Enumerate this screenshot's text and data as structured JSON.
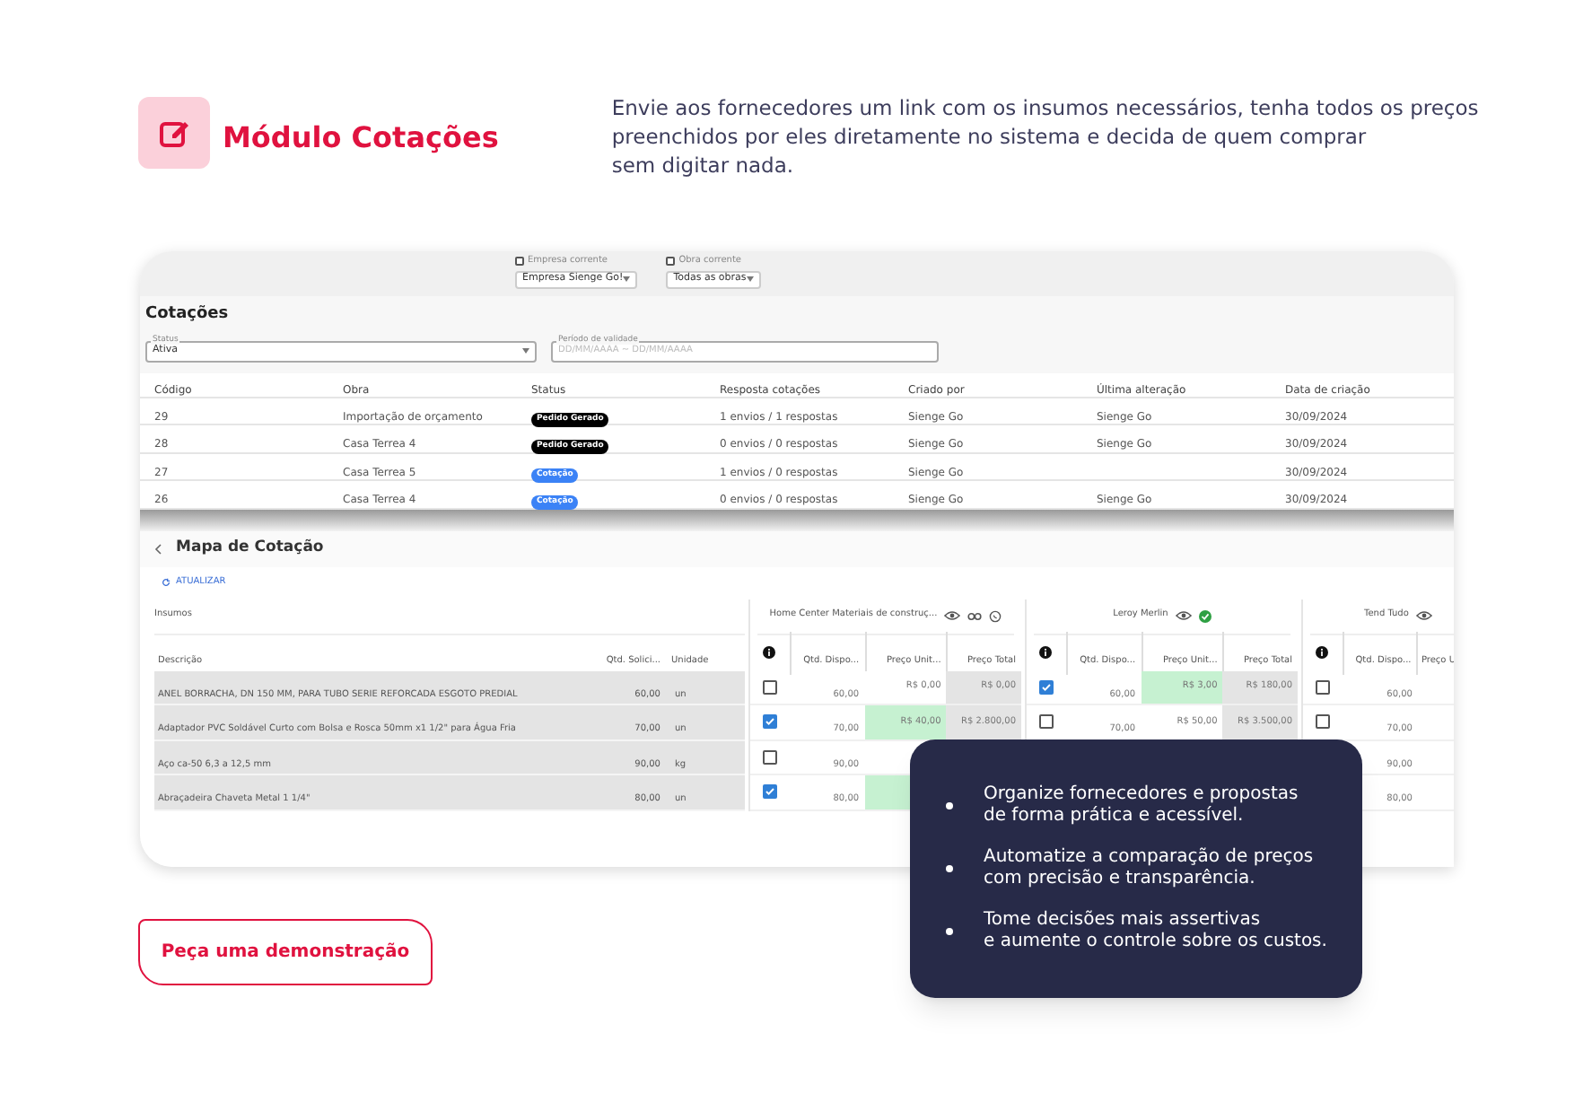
{
  "header": {
    "title": "Módulo Cotações",
    "description_lines": [
      "Envie aos fornecedores um link com os insumos necessários, tenha todos os preços",
      "preenchidos por eles diretamente no sistema e decida de quem comprar",
      "sem digitar nada."
    ]
  },
  "app": {
    "company_filter": {
      "label": "Empresa corrente",
      "checked": false,
      "value": "Empresa Sienge Go!"
    },
    "work_filter": {
      "label": "Obra corrente",
      "checked": false,
      "value": "Todas as obras"
    },
    "title": "Cotações",
    "status_filter": {
      "label": "Status",
      "value": "Ativa"
    },
    "period_filter": {
      "label": "Período de validade",
      "placeholder": "DD/MM/AAAA ~ DD/MM/AAAA"
    },
    "table": {
      "columns": [
        "Código",
        "Obra",
        "Status",
        "Resposta cotações",
        "Criado por",
        "Última alteração",
        "Data de criação"
      ],
      "rows": [
        {
          "code": "29",
          "work": "Importação de orçamento",
          "status": {
            "label": "Pedido Gerado",
            "kind": "order"
          },
          "responses": "1 envios / 1 respostas",
          "created_by": "Sienge Go",
          "last_change": "Sienge Go",
          "created": "30/09/2024"
        },
        {
          "code": "28",
          "work": "Casa Terrea 4",
          "status": {
            "label": "Pedido Gerado",
            "kind": "order"
          },
          "responses": "0 envios / 0 respostas",
          "created_by": "Sienge Go",
          "last_change": "Sienge Go",
          "created": "30/09/2024"
        },
        {
          "code": "27",
          "work": "Casa Terrea 5",
          "status": {
            "label": "Cotação",
            "kind": "quote"
          },
          "responses": "1 envios / 0 respostas",
          "created_by": "Sienge Go",
          "created": "30/09/2024"
        },
        {
          "code": "26",
          "work": "Casa Terrea 4",
          "status": {
            "label": "Cotação",
            "kind": "quote"
          },
          "responses": "0 envios / 0 respostas",
          "created_by": "Sienge Go",
          "last_change": "Sienge Go",
          "created": "30/09/2024"
        }
      ]
    }
  },
  "map": {
    "title": "Mapa de Cotação",
    "refresh": "ATUALIZAR",
    "items_group": "Insumos",
    "item_columns": [
      "Descrição",
      "Qtd. Solici...",
      "Unidade"
    ],
    "items": [
      {
        "description": "ANEL BORRACHA, DN 150 MM, PARA TUBO SERIE REFORCADA ESGOTO PREDIAL",
        "qty": "60,00",
        "unit": "un"
      },
      {
        "description": "Adaptador PVC Soldável Curto com Bolsa e Rosca 50mm x1 1/2\" para Água Fria",
        "qty": "70,00",
        "unit": "un"
      },
      {
        "description": "Aço ca-50 6,3 a 12,5 mm",
        "qty": "90,00",
        "unit": "kg"
      },
      {
        "description": "Abraçadeira Chaveta Metal 1 1/4\"",
        "qty": "80,00",
        "unit": "un"
      }
    ],
    "suppliers": [
      {
        "name": "Home Center Materiais de construç...",
        "approved": false,
        "columns": [
          "Qtd. Dispo...",
          "Preço Unit...",
          "Preço Total"
        ],
        "cells": [
          {
            "checked": false,
            "best": false,
            "qty": "60,00",
            "unit_price": "R$ 0,00",
            "total": "R$ 0,00"
          },
          {
            "checked": true,
            "best": true,
            "qty": "70,00",
            "unit_price": "R$ 40,00",
            "total": "R$ 2.800,00"
          },
          {
            "checked": false,
            "best": false,
            "qty": "90,00"
          },
          {
            "checked": true,
            "best": true,
            "qty": "80,00"
          }
        ]
      },
      {
        "name": "Leroy Merlin",
        "approved": true,
        "columns": [
          "Qtd. Dispo...",
          "Preço Unit...",
          "Preço Total"
        ],
        "cells": [
          {
            "checked": true,
            "best": true,
            "qty": "60,00",
            "unit_price": "R$ 3,00",
            "total": "R$ 180,00"
          },
          {
            "checked": false,
            "best": false,
            "qty": "70,00",
            "unit_price": "R$ 50,00",
            "total": "R$ 3.500,00"
          }
        ]
      },
      {
        "name": "Tend Tudo",
        "columns": [
          "Qtd. Dispo...",
          "Preço U"
        ],
        "cells": [
          {
            "checked": false,
            "qty": "60,00"
          },
          {
            "checked": false,
            "qty": "70,00"
          },
          {
            "qty": "90,00"
          },
          {
            "qty": "80,00"
          }
        ]
      }
    ]
  },
  "cta": "Peça uma demonstração",
  "highlights": [
    {
      "lines": [
        "Organize fornecedores e propostas",
        "de forma prática e acessível."
      ]
    },
    {
      "lines": [
        "Automatize a comparação de preços",
        "com precisão e transparência."
      ]
    },
    {
      "lines": [
        "Tome decisões mais assertivas",
        "e aumente o controle sobre os custos."
      ]
    }
  ]
}
